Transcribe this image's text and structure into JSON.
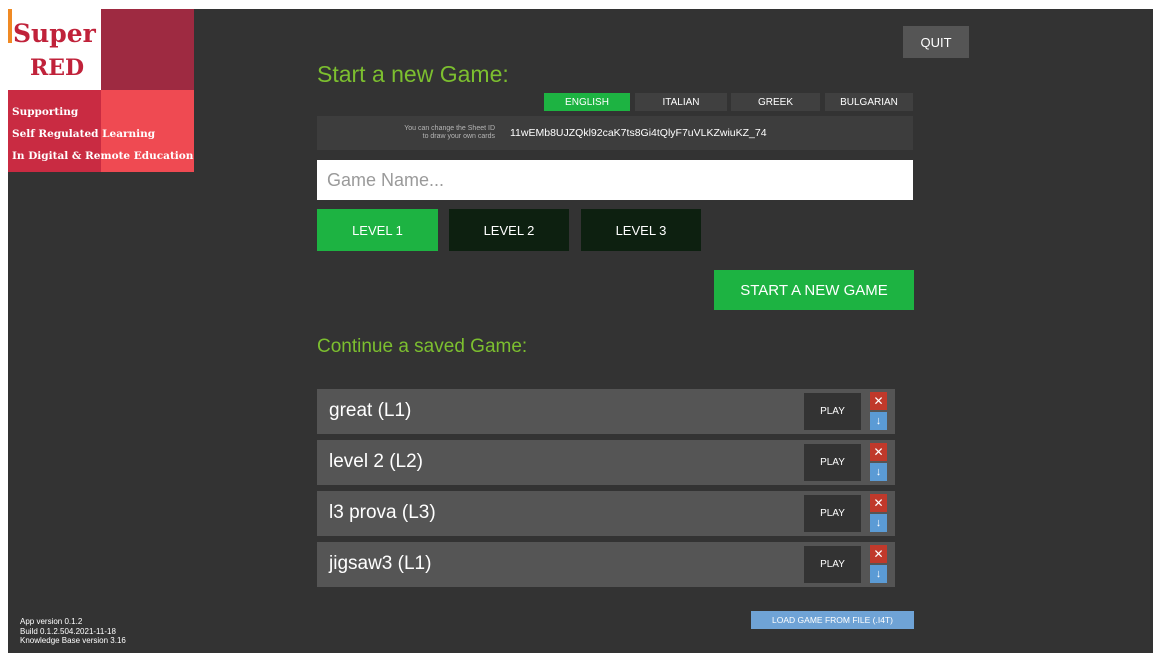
{
  "logo": {
    "title_line1": "Super",
    "title_line2": "RED",
    "tagline": [
      "Supporting",
      "Self Regulated Learning",
      "In Digital & Remote Education"
    ]
  },
  "version": {
    "app": "App version 0.1.2",
    "build": "Build 0.1.2.504.2021-11-18",
    "kb": "Knowledge Base version 3.16"
  },
  "quit_label": "QUIT",
  "new_game": {
    "title": "Start a new Game:",
    "languages": [
      {
        "label": "ENGLISH",
        "selected": true
      },
      {
        "label": "ITALIAN",
        "selected": false
      },
      {
        "label": "GREEK",
        "selected": false
      },
      {
        "label": "BULGARIAN",
        "selected": false
      }
    ],
    "sheet_help_line1": "You can change the Sheet ID",
    "sheet_help_line2": "to draw your own cards",
    "sheet_id": "11wEMb8UJZQkl92caK7ts8Gi4tQlyF7uVLKZwiuKZ_74",
    "game_name_placeholder": "Game Name...",
    "game_name_value": "",
    "levels": [
      {
        "label": "LEVEL 1",
        "selected": true
      },
      {
        "label": "LEVEL 2",
        "selected": false
      },
      {
        "label": "LEVEL 3",
        "selected": false
      }
    ],
    "start_label": "START A NEW GAME"
  },
  "continue_game": {
    "title": "Continue a saved Game:",
    "play_label": "PLAY",
    "delete_symbol": "✕",
    "download_symbol": "↓",
    "saved": [
      {
        "name": "great (L1)"
      },
      {
        "name": "level 2 (L2)"
      },
      {
        "name": "l3 prova (L3)"
      },
      {
        "name": "jigsaw3 (L1)"
      }
    ],
    "load_label": "LOAD GAME FROM FILE (.I4T)"
  },
  "colors": {
    "background": "#333333",
    "accent_green": "#1db342",
    "title_green": "#7cbf2f",
    "delete_red": "#c0392b",
    "download_blue": "#5b9bd5"
  }
}
